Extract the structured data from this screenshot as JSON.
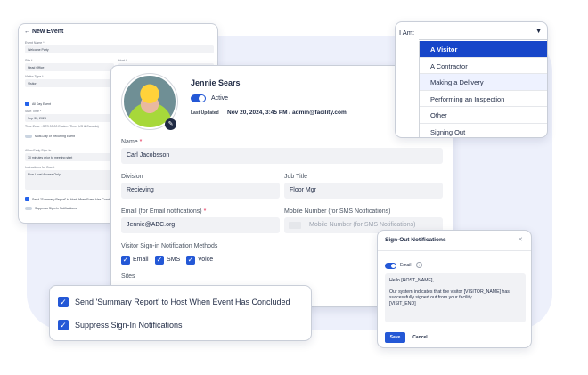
{
  "new_event": {
    "title": "New Event",
    "back_icon": "arrow-left-icon",
    "event_name_label": "Event Name *",
    "event_name_value": "Welcome Party",
    "site_label": "Site *",
    "site_value": "Head Office",
    "host_label": "Host *",
    "visitor_type_label": "Visitor Type *",
    "visitor_type_value": "Visitor",
    "all_day_label": "All Day Event",
    "start_time_label": "Start Time *",
    "start_time_value": "Sep 30, 2024",
    "timezone_text": "Time Zone : GTS 00:00 Eastern Time (US & Canada)",
    "multi_day_label": "Multi-Day or Recurring Event",
    "allow_early_label": "Allow Early Sign-In",
    "allow_early_value": "30 minutes prior to meeting start",
    "instructions_label": "Instructions for Guest",
    "instructions_value": "Blue Level Access Only",
    "send_summary_label": "Send \"Summary Report\" to Host When Event Has Concluded",
    "suppress_label": "Suppress Sign-In Notifications"
  },
  "visitor": {
    "name": "Jennie Sears",
    "status": "Active",
    "last_updated_label": "Last Updated",
    "last_updated_value": "Nov 20, 2024, 3:45 PM / admin@facility.com",
    "name_label": "Name",
    "name_value": "Carl Jacobsson",
    "division_label": "Division",
    "division_value": "Recieving",
    "job_title_label": "Job Title",
    "job_title_value": "Floor Mgr",
    "email_label": "Email (for Email notifications)",
    "email_value": "Jennie@ABC.org",
    "mobile_label": "Mobile Number (for SMS Notifications)",
    "mobile_placeholder": "Mobile Number (for SMS Notifications)",
    "methods_label": "Visitor Sign-in Notification Methods",
    "methods": [
      "Email",
      "SMS",
      "Voice"
    ],
    "sites_label": "Sites"
  },
  "dropdown": {
    "label": "I Am:",
    "options": [
      "A Visitor",
      "A Contractor",
      "Making a Delivery",
      "Performing an Inspection",
      "Other",
      "Signing Out"
    ]
  },
  "signout": {
    "title": "Sign-Out Notifications",
    "close_icon": "close-icon",
    "email_label": "Email",
    "body": "Hello [HOST_NAME],\n\nOur system indicates that the visitor [VISITOR_NAME] has successfully signed out from your facility.\n[VISIT_END]",
    "save_label": "Save",
    "cancel_label": "Cancel"
  },
  "summary": {
    "send_summary_label": "Send 'Summary Report' to Host When Event Has Concluded",
    "suppress_label": "Suppress Sign-In Notifications"
  },
  "colors": {
    "accent": "#2458d6",
    "selected": "#1746c9",
    "required": "#e11d48"
  }
}
